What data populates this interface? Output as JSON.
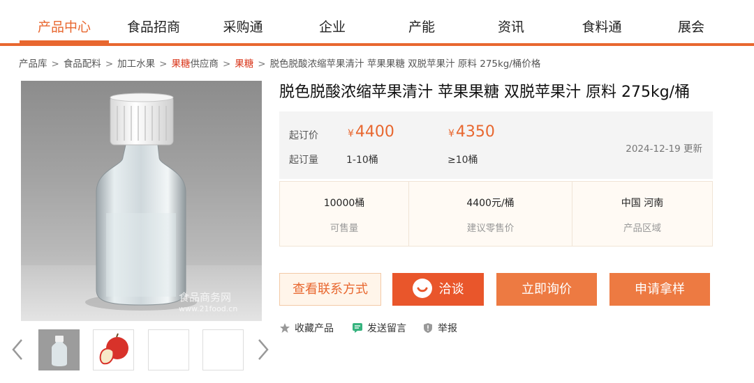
{
  "nav": {
    "items": [
      {
        "label": "产品中心"
      },
      {
        "label": "食品招商"
      },
      {
        "label": "采购通"
      },
      {
        "label": "企业"
      },
      {
        "label": "产能"
      },
      {
        "label": "资讯"
      },
      {
        "label": "食料通"
      },
      {
        "label": "展会"
      }
    ],
    "active_color": "#e8672f"
  },
  "breadcrumb": {
    "items": [
      "产品库",
      "食品配料",
      "加工水果",
      "果糖",
      "供应商",
      "果糖",
      "脱色脱酸浓缩苹果清汁 苹果果糖 双脱苹果汁 原料 275kg/桶价格"
    ],
    "separator": ">"
  },
  "gallery": {
    "watermark_name": "食品商务网",
    "watermark_url": "www.21food.cn",
    "thumbnails": [
      "bottle-thumb",
      "apple-thumb",
      "empty-thumb",
      "empty-thumb"
    ]
  },
  "product": {
    "title": "脱色脱酸浓缩苹果清汁 苹果果糖 双脱苹果汁 原料 275kg/桶",
    "price_label": "起订价",
    "qty_label": "起订量",
    "currency": "¥",
    "tiers": [
      {
        "price": "4400",
        "qty": "1-10桶"
      },
      {
        "price": "4350",
        "qty": "≥10桶"
      }
    ],
    "updated": "2024-12-19 更新"
  },
  "info": [
    {
      "value": "10000桶",
      "label": "可售量"
    },
    {
      "value": "4400元/桶",
      "label": "建议零售价"
    },
    {
      "value": "中国 河南",
      "label": "产品区域"
    }
  ],
  "actions": {
    "contact": "查看联系方式",
    "chat": "洽谈",
    "inquire": "立即询价",
    "sample": "申请拿样"
  },
  "links": {
    "favorite": "收藏产品",
    "message": "发送留言",
    "report": "举报"
  },
  "colors": {
    "accent": "#e8672f",
    "button_dark": "#e9562b",
    "button": "#ed7a42",
    "breadcrumb_highlight": "#d9361b"
  }
}
